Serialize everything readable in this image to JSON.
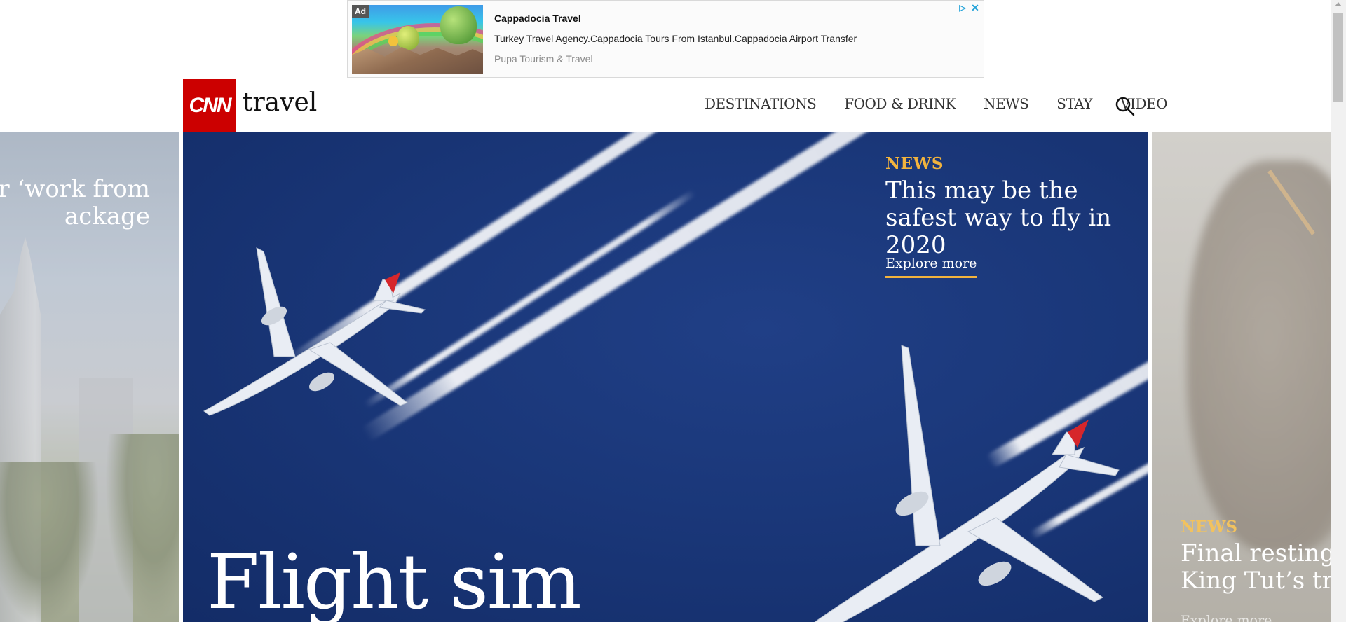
{
  "ad": {
    "badge": "Ad",
    "title": "Cappadocia Travel",
    "description": "Turkey Travel Agency.Cappadocia Tours From Istanbul.Cappadocia Airport Transfer",
    "advertiser": "Pupa Tourism & Travel",
    "choices_icon": "adchoices-icon",
    "close_icon": "close-icon"
  },
  "header": {
    "logo_text": "CNN",
    "brand_word": "travel",
    "nav": [
      "DESTINATIONS",
      "FOOD & DRINK",
      "NEWS",
      "STAY",
      "VIDEO"
    ],
    "search_icon": "search-icon"
  },
  "slides": {
    "left": {
      "headline_line1": "fer ‘work from",
      "headline_line2": "ackage"
    },
    "main": {
      "eyebrow": "NEWS",
      "headline": "This may be the safest way to fly in 2020",
      "cta": "Explore more",
      "big_title": "Flight sim"
    },
    "right": {
      "eyebrow": "NEWS",
      "headline_line1": "Final resting p",
      "headline_line2": "King Tut’s trea",
      "cta": "Explore more"
    }
  },
  "colors": {
    "brand_red": "#cc0000",
    "accent_gold": "#f2b33d",
    "sky_blue": "#1a3779"
  }
}
